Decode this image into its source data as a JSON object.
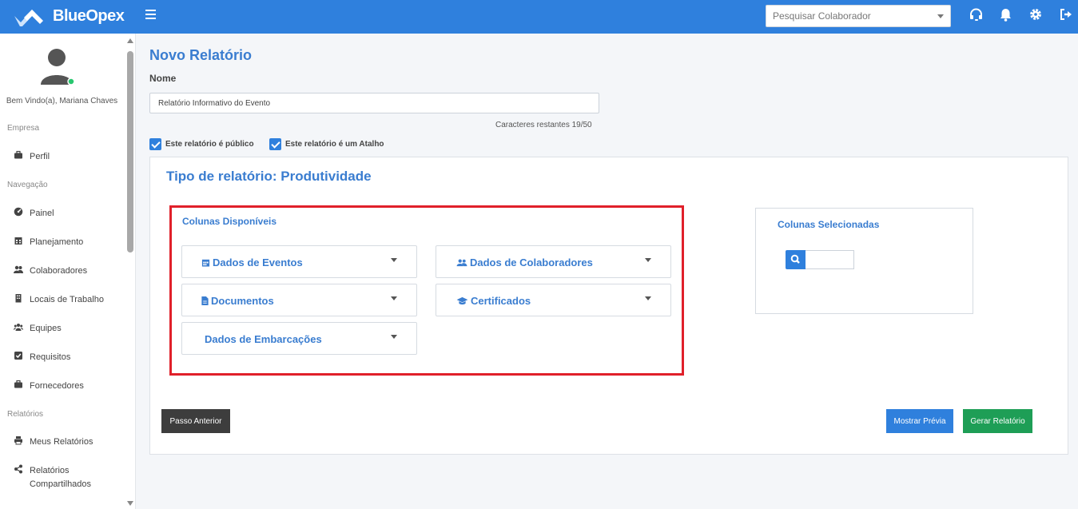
{
  "app": {
    "name": "BlueOpex"
  },
  "header": {
    "search_placeholder": "Pesquisar Colaborador",
    "icons": [
      "headset-icon",
      "bell-icon",
      "gear-icon",
      "logout-icon"
    ]
  },
  "sidebar": {
    "welcome": "Bem Vindo(a), Mariana Chaves",
    "sections": {
      "empresa": "Empresa",
      "navegacao": "Navegação",
      "relatorios": "Relatórios"
    },
    "items": {
      "perfil": "Perfil",
      "painel": "Painel",
      "planejamento": "Planejamento",
      "colaboradores": "Colaboradores",
      "locais": "Locais de Trabalho",
      "equipes": "Equipes",
      "requisitos": "Requisitos",
      "fornecedores": "Fornecedores",
      "meus_relatorios": "Meus Relatórios",
      "relatorios_compartilhados": "Relatórios Compartilhados"
    }
  },
  "main": {
    "title": "Novo Relatório",
    "name_label": "Nome",
    "name_value": "Relatório Informativo do Evento",
    "chars_remaining": "Caracteres restantes 19/50",
    "checkbox_public": "Este relatório é público",
    "checkbox_shortcut": "Este relatório é um Atalho",
    "report_type": "Tipo de relatório: Produtividade",
    "available_title": "Colunas Disponíveis",
    "groups": {
      "eventos": "Dados de Eventos",
      "colaboradores": "Dados de Colaboradores",
      "documentos": "Documentos",
      "certificados": "Certificados",
      "embarcacoes": "Dados de Embarcações"
    },
    "selected_title": "Colunas Selecionadas",
    "buttons": {
      "previous": "Passo Anterior",
      "preview": "Mostrar Prévia",
      "generate": "Gerar Relatório"
    }
  },
  "colors": {
    "primary": "#2f80dd",
    "highlight_border": "#e0202a",
    "success": "#1e9e56",
    "dark_button": "#3d3d3d"
  }
}
